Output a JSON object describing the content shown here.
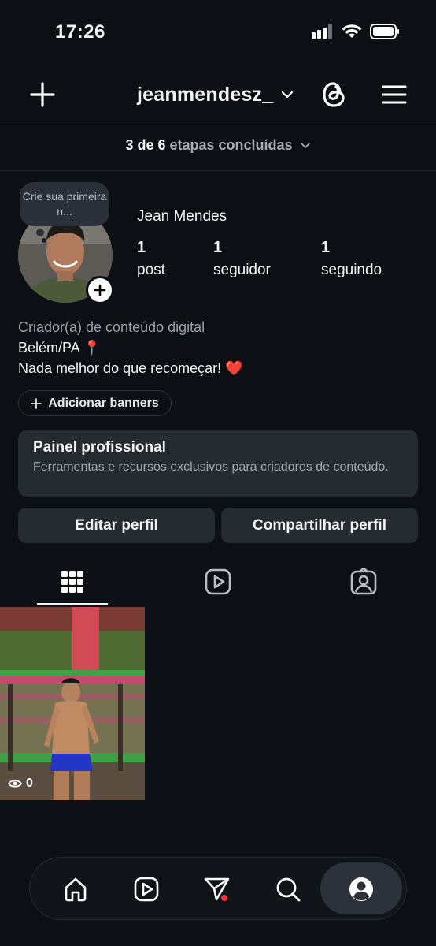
{
  "status": {
    "time": "17:26"
  },
  "header": {
    "username": "jeanmendesz_"
  },
  "setup": {
    "progress": "3 de 6",
    "label": "etapas concluídas"
  },
  "profile": {
    "note": "Crie sua primeira n...",
    "name": "Jean Mendes",
    "stats": [
      {
        "value": "1",
        "label": "post"
      },
      {
        "value": "1",
        "label": "seguidor"
      },
      {
        "value": "1",
        "label": "seguindo"
      }
    ],
    "bio": {
      "category": "Criador(a) de conteúdo digital",
      "location": "Belém/PA",
      "location_emoji": "📍",
      "text": "Nada melhor do que recomeçar!",
      "text_emoji": "❤️"
    }
  },
  "buttons": {
    "add_banners": "Adicionar banners",
    "edit_profile": "Editar perfil",
    "share_profile": "Compartilhar perfil"
  },
  "pro_panel": {
    "title": "Painel profissional",
    "subtitle": "Ferramentas e recursos exclusivos para criadores de conteúdo."
  },
  "posts": [
    {
      "views": "0"
    }
  ],
  "tabs": [
    "grid-icon",
    "reels-icon",
    "tagged-icon"
  ],
  "nav": [
    "home-icon",
    "reels-icon",
    "direct-icon",
    "search-icon",
    "profile-icon"
  ],
  "colors": {
    "background": "#0c0f14",
    "surface": "#262a31",
    "notification_dot": "#ff3040"
  }
}
